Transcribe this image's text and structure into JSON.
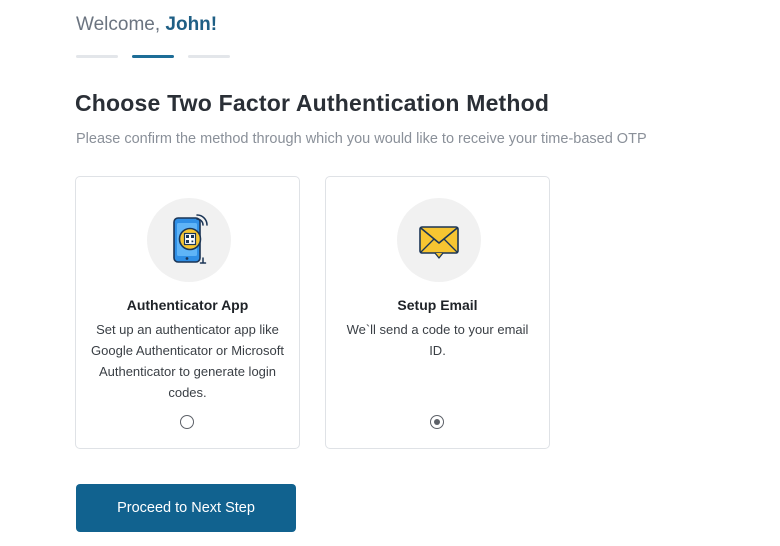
{
  "header": {
    "welcome_prefix": "Welcome, ",
    "user_name": "John!"
  },
  "stepper": {
    "total_steps": 3,
    "current_step": 2
  },
  "main": {
    "title": "Choose Two Factor Authentication Method",
    "subtitle": "Please confirm the method through which you would like to receive your time-based OTP"
  },
  "options": [
    {
      "title": "Authenticator App",
      "description": "Set up an authenticator app like Google Authenticator or Microsoft Authenticator to generate login codes.",
      "icon": "phone-qr-icon",
      "selected": false
    },
    {
      "title": "Setup Email",
      "description": "We`ll send a code to your email ID.",
      "icon": "envelope-icon",
      "selected": true
    }
  ],
  "actions": {
    "proceed_label": "Proceed to Next Step"
  },
  "colors": {
    "accent": "#11628f",
    "user_name": "#1f5f85",
    "step_active": "#1d6d97",
    "step_inactive": "#e3e6ea"
  }
}
